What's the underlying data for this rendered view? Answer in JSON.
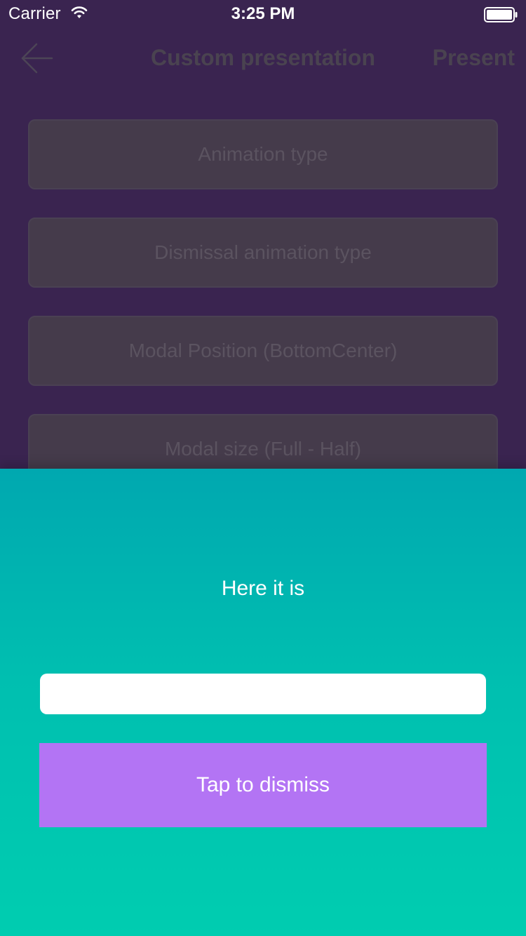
{
  "status_bar": {
    "carrier": "Carrier",
    "time": "3:25 PM"
  },
  "nav": {
    "title": "Custom presentation",
    "present_label": "Present",
    "back_icon": "arrow-left-icon"
  },
  "options": [
    {
      "label": "Animation type"
    },
    {
      "label": "Dismissal animation type"
    },
    {
      "label": "Modal Position (BottomCenter)"
    },
    {
      "label": "Modal size (Full - Half)"
    }
  ],
  "modal": {
    "label": "Here it is",
    "input_value": "",
    "input_placeholder": "",
    "dismiss_label": "Tap to dismiss"
  },
  "colors": {
    "background": "#3a2450",
    "modal_gradient_top": "#00a8b0",
    "modal_gradient_bottom": "#00cdb0",
    "dismiss_button": "#b374f4"
  }
}
